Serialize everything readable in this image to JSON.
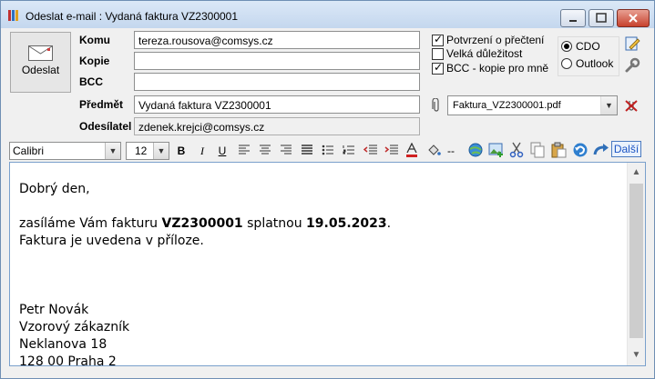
{
  "window": {
    "title": "Odeslat e-mail : Vydaná faktura VZ2300001"
  },
  "send_button": {
    "label": "Odeslat"
  },
  "fields": {
    "to_label": "Komu",
    "to_value": "tereza.rousova@comsys.cz",
    "cc_label": "Kopie",
    "cc_value": "",
    "bcc_label": "BCC",
    "bcc_value": "",
    "subject_label": "Předmět",
    "subject_value": "Vydaná faktura VZ2300001",
    "sender_label": "Odesílatel",
    "sender_value": "zdenek.krejci@comsys.cz"
  },
  "options": [
    {
      "label": "Potvrzení o přečtení",
      "checked": true
    },
    {
      "label": "Velká důležitost",
      "checked": false
    },
    {
      "label": "BCC - kopie pro mně",
      "checked": true
    }
  ],
  "transport": {
    "cdo_label": "CDO",
    "outlook_label": "Outlook",
    "selected": "CDO"
  },
  "attachment": {
    "value": "Faktura_VZ2300001.pdf"
  },
  "toolbar": {
    "font": "Calibri",
    "size": "12",
    "bold": "B",
    "italic": "I",
    "underline": "U",
    "more_label": "Další",
    "separator": "--"
  },
  "body": {
    "greeting": "Dobrý den,",
    "line1_pre": "zasíláme Vám fakturu ",
    "line1_invoice": "VZ2300001",
    "line1_mid": " splatnou ",
    "line1_date": "19.05.2023",
    "line1_end": ".",
    "line2": "Faktura je uvedena v příloze.",
    "sig_name": "Petr Novák",
    "sig_company": "Vzorový zákazník",
    "sig_street": "Neklanova 18",
    "sig_city": "128 00 Praha 2"
  },
  "colors": {
    "accent": "#1d56c4",
    "border": "#7aa0cc",
    "delete_icon": "#c02020"
  }
}
